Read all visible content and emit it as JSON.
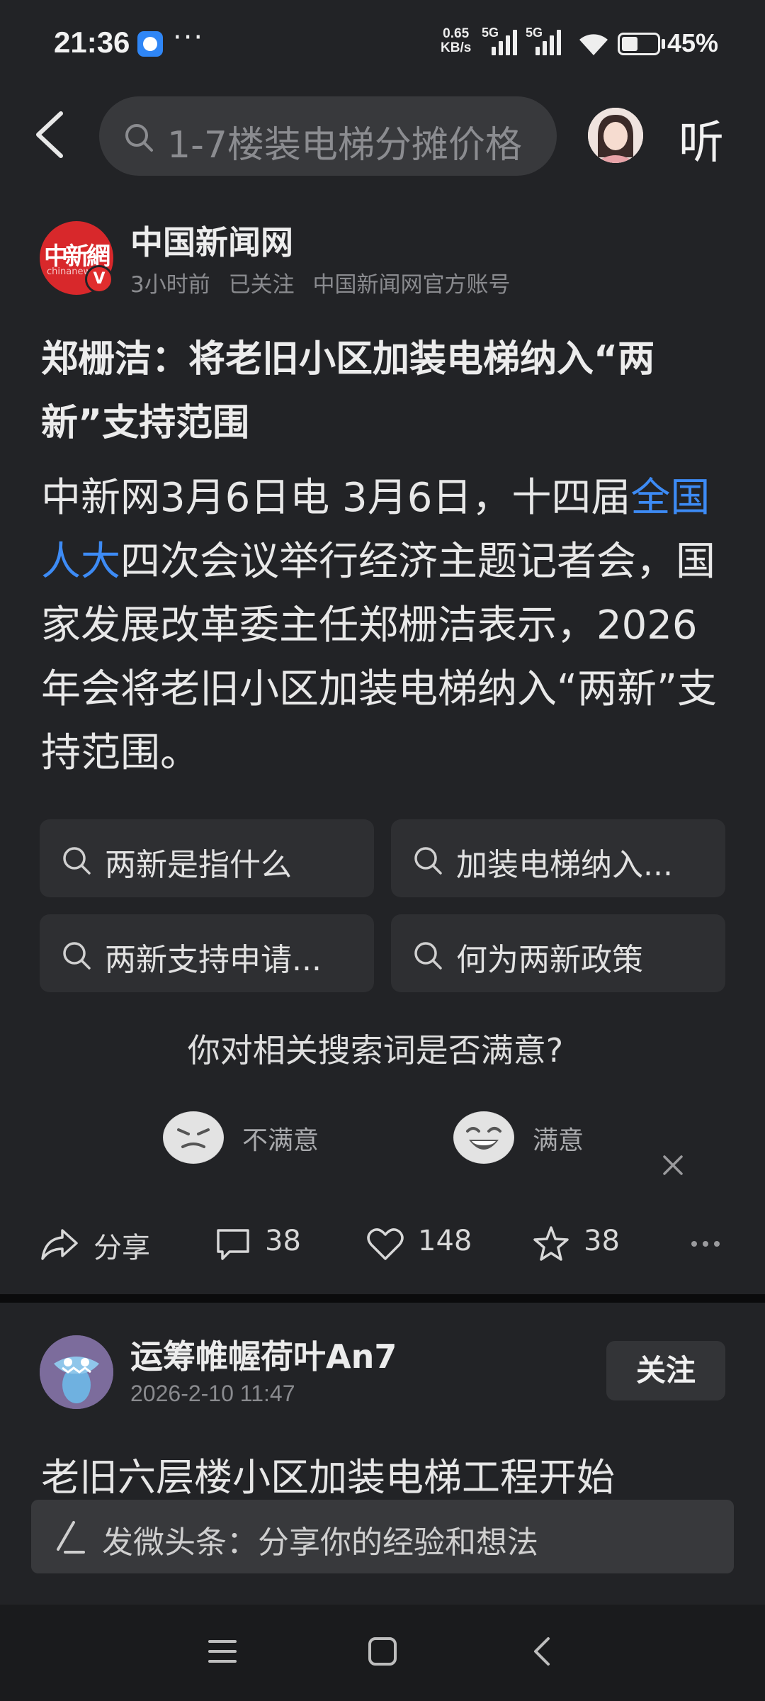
{
  "status_bar": {
    "time": "21:36",
    "dots": "···",
    "net_speed_value": "0.65",
    "net_speed_unit": "KB/s",
    "signal1_label": "5G",
    "signal2_label": "5G",
    "battery_text": "45%",
    "battery_level": 0.45,
    "app_icon": "browser-app-icon"
  },
  "top_nav": {
    "search_text": "1-7楼装电梯分摊价格",
    "listen_label": "听"
  },
  "source": {
    "logo_text": "中新網",
    "logo_sub": "chinanews",
    "badge": "V",
    "name": "中国新闻网",
    "time_ago": "3小时前",
    "follow_state": "已关注",
    "account_desc": "中国新闻网官方账号"
  },
  "article": {
    "title": "郑栅洁：将老旧小区加装电梯纳入“两新”支持范围",
    "body_before": "中新网3月6日电 3月6日，十四届",
    "body_link": "全国人大",
    "body_after": "四次会议举行经济主题记者会，国家发展改革委主任郑栅洁表示，2026年会将老旧小区加装电梯纳入“两新”支持范围。"
  },
  "related_searches": [
    {
      "label": "两新是指什么"
    },
    {
      "label": "加装电梯纳入..."
    },
    {
      "label": "两新支持申请..."
    },
    {
      "label": "何为两新政策"
    }
  ],
  "feedback": {
    "question": "你对相关搜索词是否满意?",
    "unsatisfied": "不满意",
    "satisfied": "满意"
  },
  "actions": {
    "share": "分享",
    "comments": "38",
    "likes": "148",
    "favorites": "38"
  },
  "next_card": {
    "author": "运筹帷幄荷叶An7",
    "time": "2026-2-10 11:47",
    "follow": "关注",
    "title": "老旧六层楼小区加装电梯工程开始"
  },
  "compose": {
    "placeholder": "发微头条：分享你的经验和想法"
  }
}
